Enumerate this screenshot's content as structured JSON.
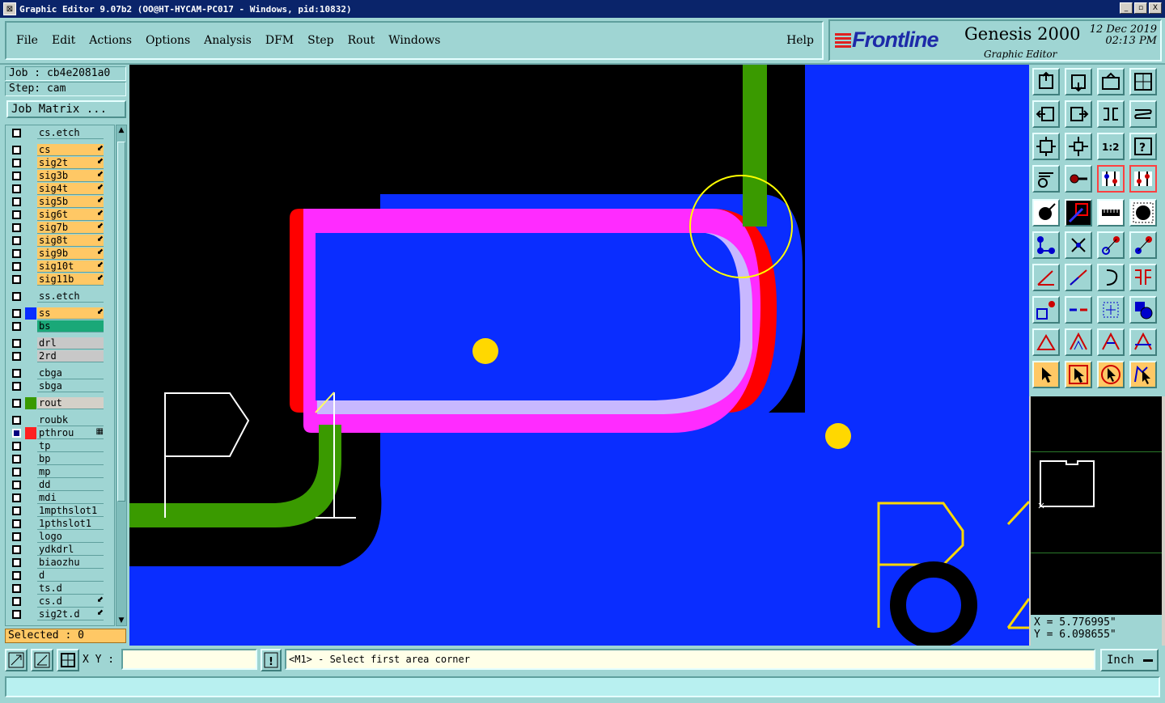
{
  "window": {
    "title": "Graphic Editor 9.07b2 (OO@HT-HYCAM-PC017 - Windows, pid:10832)",
    "controls": [
      "_",
      "▫",
      "X"
    ]
  },
  "menu": {
    "items": [
      "File",
      "Edit",
      "Actions",
      "Options",
      "Analysis",
      "DFM",
      "Step",
      "Rout",
      "Windows"
    ],
    "help": "Help"
  },
  "brand": {
    "logo": "Frontline",
    "product": "Genesis 2000",
    "subtitle": "Graphic Editor",
    "date": "12 Dec 2019",
    "time": "02:13 PM"
  },
  "job": {
    "job_label": "Job : cb4e2081a0",
    "step_label": "Step: cam",
    "matrix_button": "Job Matrix ..."
  },
  "layers": [
    {
      "name": "cs.etch",
      "color": "#9fd5d3",
      "swatch": "",
      "checked": false,
      "mark": ""
    },
    {
      "name": "cs",
      "color": "#ffc865",
      "swatch": "",
      "checked": false,
      "mark": "⬋"
    },
    {
      "name": "sig2t",
      "color": "#ffc865",
      "swatch": "",
      "checked": false,
      "mark": "⬋"
    },
    {
      "name": "sig3b",
      "color": "#ffc865",
      "swatch": "",
      "checked": false,
      "mark": "⬋"
    },
    {
      "name": "sig4t",
      "color": "#ffc865",
      "swatch": "",
      "checked": false,
      "mark": "⬋"
    },
    {
      "name": "sig5b",
      "color": "#ffc865",
      "swatch": "",
      "checked": false,
      "mark": "⬋"
    },
    {
      "name": "sig6t",
      "color": "#ffc865",
      "swatch": "",
      "checked": false,
      "mark": "⬋"
    },
    {
      "name": "sig7b",
      "color": "#ffc865",
      "swatch": "",
      "checked": false,
      "mark": "⬋"
    },
    {
      "name": "sig8t",
      "color": "#ffc865",
      "swatch": "",
      "checked": false,
      "mark": "⬋"
    },
    {
      "name": "sig9b",
      "color": "#ffc865",
      "swatch": "",
      "checked": false,
      "mark": "⬋"
    },
    {
      "name": "sig10t",
      "color": "#ffc865",
      "swatch": "",
      "checked": false,
      "mark": "⬋"
    },
    {
      "name": "sig11b",
      "color": "#ffc865",
      "swatch": "",
      "checked": false,
      "mark": "⬋"
    },
    {
      "name": "ss.etch",
      "color": "#9fd5d3",
      "swatch": "",
      "checked": false,
      "mark": ""
    },
    {
      "name": "ss",
      "color": "#ffc865",
      "swatch": "#0a2dff",
      "checked": false,
      "mark": "⬋"
    },
    {
      "name": "bs",
      "color": "#1aa878",
      "swatch": "",
      "checked": false,
      "mark": ""
    },
    {
      "name": "drl",
      "color": "#c8c8c8",
      "swatch": "",
      "checked": false,
      "mark": ""
    },
    {
      "name": "2rd",
      "color": "#c8c8c8",
      "swatch": "",
      "checked": false,
      "mark": ""
    },
    {
      "name": "cbga",
      "color": "#9fd5d3",
      "swatch": "",
      "checked": false,
      "mark": ""
    },
    {
      "name": "sbga",
      "color": "#9fd5d3",
      "swatch": "",
      "checked": false,
      "mark": ""
    },
    {
      "name": "rout",
      "color": "#d4d0c8",
      "swatch": "#3a9a00",
      "checked": false,
      "mark": ""
    },
    {
      "name": "roubk",
      "color": "#9fd5d3",
      "swatch": "",
      "checked": false,
      "mark": ""
    },
    {
      "name": "pthrou",
      "color": "#9fd5d3",
      "swatch": "#ff2020",
      "checked": true,
      "mark": "▦"
    },
    {
      "name": "tp",
      "color": "#9fd5d3",
      "swatch": "",
      "checked": false,
      "mark": ""
    },
    {
      "name": "bp",
      "color": "#9fd5d3",
      "swatch": "",
      "checked": false,
      "mark": ""
    },
    {
      "name": "mp",
      "color": "#9fd5d3",
      "swatch": "",
      "checked": false,
      "mark": ""
    },
    {
      "name": "dd",
      "color": "#9fd5d3",
      "swatch": "",
      "checked": false,
      "mark": ""
    },
    {
      "name": "mdi",
      "color": "#9fd5d3",
      "swatch": "",
      "checked": false,
      "mark": ""
    },
    {
      "name": "1mpthslot1",
      "color": "#9fd5d3",
      "swatch": "",
      "checked": false,
      "mark": ""
    },
    {
      "name": "1pthslot1",
      "color": "#9fd5d3",
      "swatch": "",
      "checked": false,
      "mark": ""
    },
    {
      "name": "logo",
      "color": "#9fd5d3",
      "swatch": "",
      "checked": false,
      "mark": ""
    },
    {
      "name": "ydkdrl",
      "color": "#9fd5d3",
      "swatch": "",
      "checked": false,
      "mark": ""
    },
    {
      "name": "biaozhu",
      "color": "#9fd5d3",
      "swatch": "",
      "checked": false,
      "mark": ""
    },
    {
      "name": "d",
      "color": "#9fd5d3",
      "swatch": "",
      "checked": false,
      "mark": ""
    },
    {
      "name": "ts.d",
      "color": "#9fd5d3",
      "swatch": "",
      "checked": false,
      "mark": ""
    },
    {
      "name": "cs.d",
      "color": "#9fd5d3",
      "swatch": "",
      "checked": false,
      "mark": "⬋"
    },
    {
      "name": "sig2t.d",
      "color": "#9fd5d3",
      "swatch": "",
      "checked": false,
      "mark": "⬋"
    }
  ],
  "selected": "Selected : 0",
  "coordinates": {
    "x": "X = 5.776995\"",
    "y": "Y = 6.098655\""
  },
  "bottom": {
    "xy_label": "X Y :",
    "xy_value": "",
    "prompt": "<M1> - Select first area corner",
    "units": "Inch"
  },
  "colors": {
    "copper_blue": "#0a2dff",
    "pad_magenta": "#ff2bff",
    "pad_red": "#ff0000",
    "rout_green": "#3a9a00",
    "drill_yellow": "#ffd800",
    "panel_teal": "#9fd5d3",
    "toolbar_orange": "#ffc865"
  }
}
